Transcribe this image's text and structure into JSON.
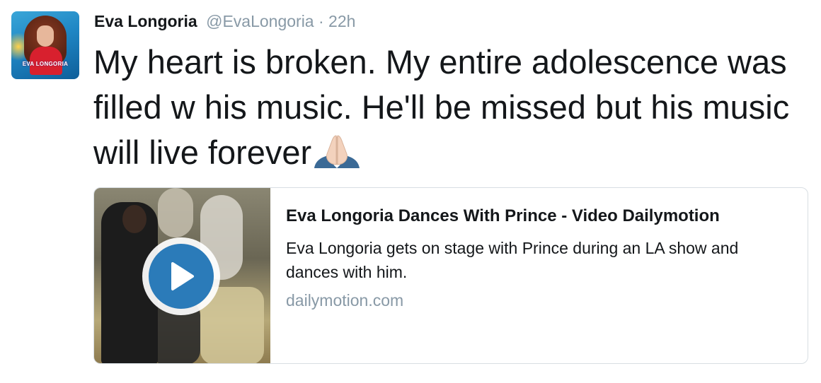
{
  "tweet": {
    "author_name": "Eva Longoria",
    "handle": "@EvaLongoria",
    "separator": "·",
    "timestamp": "22h",
    "text": "My heart is broken. My entire adolescence was filled w his music. He'll be missed but his music will live forever",
    "emoji_icon": "folded-hands-icon",
    "avatar_text": "EVA LONGORIA"
  },
  "card": {
    "title": "Eva Longoria Dances With Prince - Video Dailymotion",
    "description": "Eva Longoria gets on stage with Prince during an LA show and dances with him.",
    "domain": "dailymotion.com",
    "play_icon": "play-icon"
  },
  "colors": {
    "text": "#14171a",
    "muted": "#8899a6",
    "border": "#d8dee3",
    "play_blue": "#2b7bb9"
  }
}
